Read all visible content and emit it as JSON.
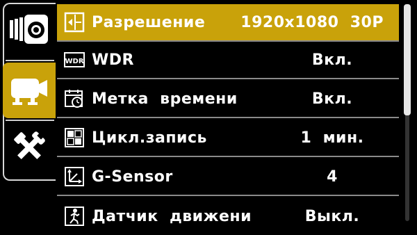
{
  "colors": {
    "accent": "#c9a20a",
    "background": "#000000",
    "text": "#ffffff",
    "divider": "#8a8a8a"
  },
  "tabs": [
    {
      "name": "photo-camera-tab",
      "icon": "camera-icon",
      "selected": false
    },
    {
      "name": "video-camera-tab",
      "icon": "video-camera-icon",
      "selected": true
    },
    {
      "name": "settings-tab",
      "icon": "tools-icon",
      "selected": false
    }
  ],
  "menu": {
    "items": [
      {
        "icon": "resolution-icon",
        "label": "Разрешение",
        "value": "1920x1080  30P",
        "selected": true
      },
      {
        "icon": "wdr-icon",
        "label": "WDR",
        "value": "Вкл.",
        "selected": false
      },
      {
        "icon": "date-stamp-icon",
        "label": "Метка  времени",
        "value": "Вкл.",
        "selected": false
      },
      {
        "icon": "loop-record-icon",
        "label": "Цикл.запись",
        "value": "1  мин.",
        "selected": false
      },
      {
        "icon": "g-sensor-icon",
        "label": "G-Sensor",
        "value": "4",
        "selected": false
      },
      {
        "icon": "motion-detect-icon",
        "label": "Датчик  движени",
        "value": "Выкл.",
        "selected": false
      }
    ]
  },
  "scrollbar": {
    "position": 0,
    "visible_fraction": 0.5
  }
}
